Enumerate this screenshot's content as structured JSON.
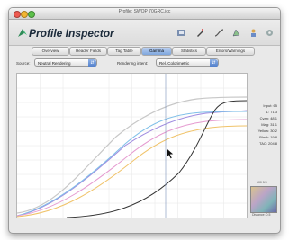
{
  "window": {
    "title": "Profile: SWOP 70GRC.icc"
  },
  "app": {
    "title": "Profile Inspector"
  },
  "toolbar": {
    "icons": [
      "profile-icon",
      "pencil-icon",
      "curves-icon",
      "gamut-icon",
      "person-icon",
      "settings-icon"
    ]
  },
  "tabs": [
    {
      "label": "Overview",
      "active": false
    },
    {
      "label": "Header Fields",
      "active": false
    },
    {
      "label": "Tag Table",
      "active": false
    },
    {
      "label": "Gamma",
      "active": true
    },
    {
      "label": "Statistics",
      "active": false
    },
    {
      "label": "Errors/Warnings",
      "active": false
    }
  ],
  "settings": {
    "source_label": "Source:",
    "source_value": "Neutral Rendering",
    "rendering_label": "Rendering intent:",
    "rendering_value": "Rel. Colorimetric"
  },
  "readout": [
    "Input: 65",
    "L: 71.3",
    "Cyan: 48.1",
    "Mag: 31.1",
    "Yellow: 30.2",
    "Black: 19.8",
    "TAC: 204.8"
  ],
  "swatch": {
    "top_label": "100 0/0",
    "bottom_label": "Distance: 0.5"
  },
  "colors": {
    "cyan": "#7fbfe8",
    "magenta": "#e59ad0",
    "yellow": "#f0c36a",
    "black": "#333333",
    "lightness": "#c7c7c7",
    "purple": "#9f8be0",
    "accent_tab": "#7ea6dd"
  }
}
